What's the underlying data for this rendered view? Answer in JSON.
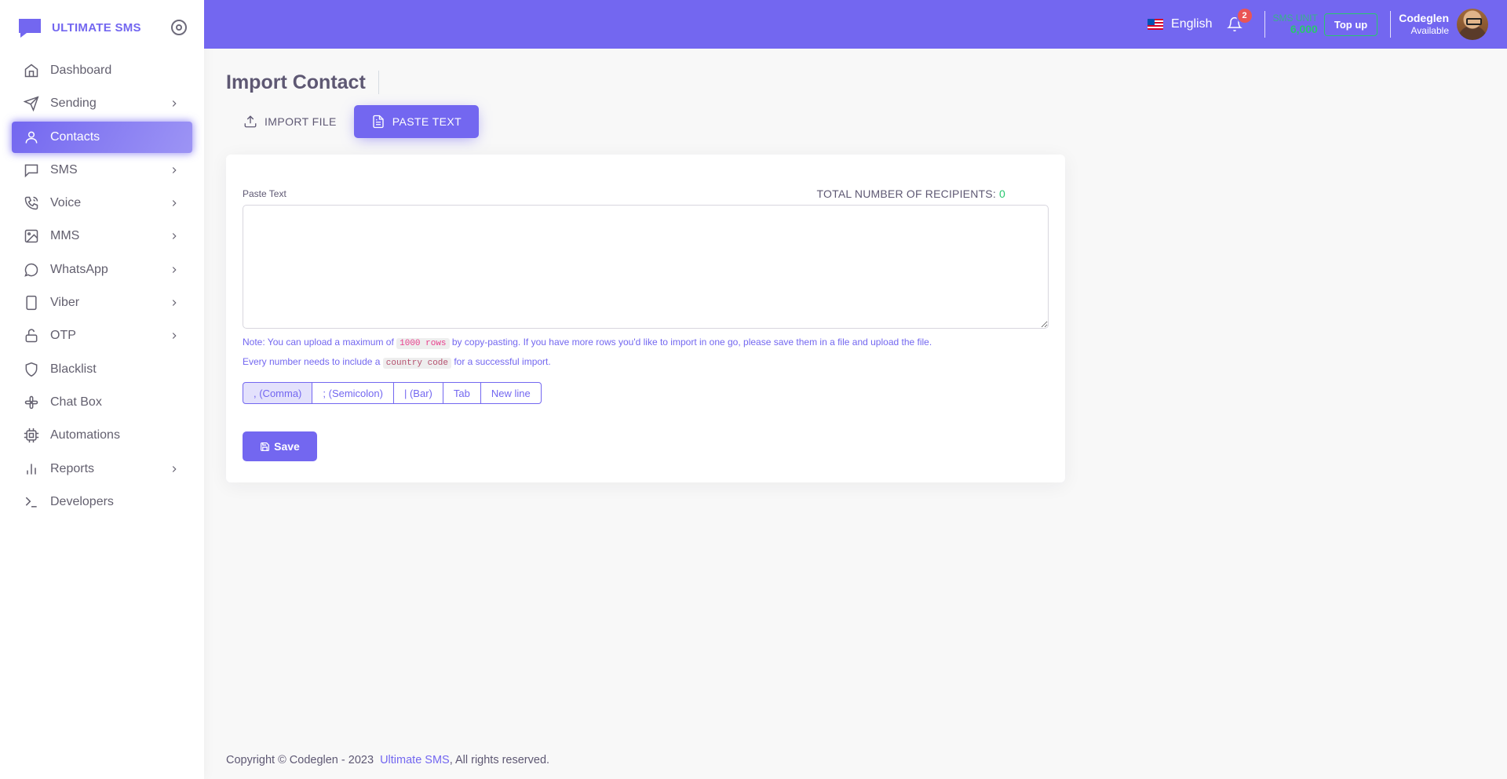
{
  "brand": {
    "name": "ULTIMATE SMS"
  },
  "sidebar": {
    "items": [
      {
        "label": "Dashboard",
        "icon": "home-icon",
        "has_children": false
      },
      {
        "label": "Sending",
        "icon": "send-icon",
        "has_children": true
      },
      {
        "label": "Contacts",
        "icon": "user-icon",
        "has_children": false,
        "active": true
      },
      {
        "label": "SMS",
        "icon": "message-square-icon",
        "has_children": true
      },
      {
        "label": "Voice",
        "icon": "phone-call-icon",
        "has_children": true
      },
      {
        "label": "MMS",
        "icon": "image-icon",
        "has_children": true
      },
      {
        "label": "WhatsApp",
        "icon": "message-circle-icon",
        "has_children": true
      },
      {
        "label": "Viber",
        "icon": "tablet-icon",
        "has_children": true
      },
      {
        "label": "OTP",
        "icon": "unlock-icon",
        "has_children": true
      },
      {
        "label": "Blacklist",
        "icon": "shield-icon",
        "has_children": false
      },
      {
        "label": "Chat Box",
        "icon": "slack-icon",
        "has_children": false
      },
      {
        "label": "Automations",
        "icon": "cpu-icon",
        "has_children": false
      },
      {
        "label": "Reports",
        "icon": "bar-chart-icon",
        "has_children": true
      },
      {
        "label": "Developers",
        "icon": "terminal-icon",
        "has_children": false
      }
    ]
  },
  "header": {
    "language": "English",
    "notifications_count": "2",
    "sms_unit_label": "SMS UNIT",
    "sms_unit_value": "6,000",
    "topup_label": "Top up",
    "user_name": "Codeglen",
    "user_status": "Available"
  },
  "page": {
    "title": "Import Contact",
    "tabs": [
      {
        "label": "IMPORT FILE",
        "icon": "upload-icon",
        "active": false
      },
      {
        "label": "PASTE TEXT",
        "icon": "file-text-icon",
        "active": true
      }
    ]
  },
  "form": {
    "paste_label": "Paste Text",
    "recipients_label": "TOTAL NUMBER OF RECIPIENTS: ",
    "recipients_count": "0",
    "textarea_value": "",
    "note_line1_pre": "Note: You can upload a maximum of ",
    "note_line1_code": "1000 rows",
    "note_line1_post": " by copy-pasting. If you have more rows you'd like to import in one go, please save them in a file and upload the file.",
    "note_line2_pre": "Every number needs to include a ",
    "note_line2_code": "country code",
    "note_line2_post": " for a successful import.",
    "delimiters": [
      ", (Comma)",
      "; (Semicolon)",
      "| (Bar)",
      "Tab",
      "New line"
    ],
    "selected_delimiter": ", (Comma)",
    "save_label": "Save"
  },
  "footer": {
    "text_pre": "Copyright © Codeglen - 2023  ",
    "link": "Ultimate SMS",
    "text_post": ", All rights reserved."
  },
  "colors": {
    "primary": "#7367f0",
    "success": "#28c76f",
    "danger": "#ea5455"
  }
}
